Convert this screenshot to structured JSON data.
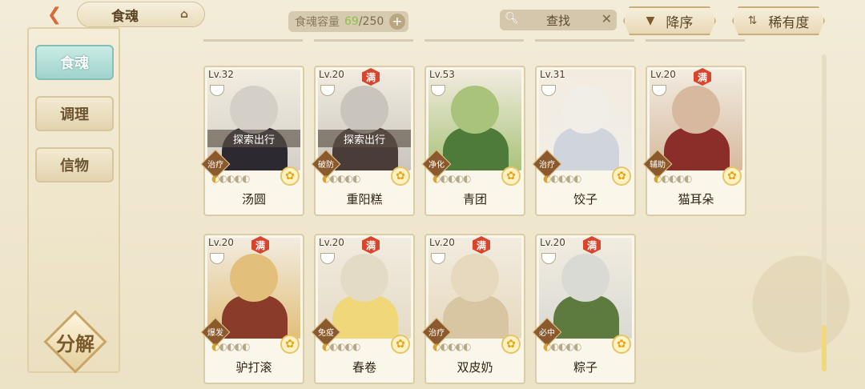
{
  "header": {
    "title": "食魂",
    "capacity_label": "食魂容量",
    "capacity_current": "69",
    "capacity_max": "/250",
    "search_placeholder": "查找",
    "sort_desc_label": "降序",
    "sort_rarity_label": "稀有度"
  },
  "sidebar": {
    "items": [
      {
        "label": "食魂"
      },
      {
        "label": "调理"
      },
      {
        "label": "信物"
      }
    ],
    "decompose_label": "分解"
  },
  "cards": [
    {
      "level": "Lv.32",
      "name": "汤圆",
      "full": false,
      "explore": "探索出行",
      "role": "治疗",
      "stars_lit": 1,
      "colors": [
        "#d4d0c8",
        "#2c2a30"
      ]
    },
    {
      "level": "Lv.20",
      "name": "重阳糕",
      "full": true,
      "explore": "探索出行",
      "role": "破防",
      "stars_lit": 1,
      "colors": [
        "#c9c4bc",
        "#4a3d38"
      ]
    },
    {
      "level": "Lv.53",
      "name": "青团",
      "full": false,
      "explore": "",
      "role": "净化",
      "stars_lit": 1,
      "colors": [
        "#a9c37a",
        "#4e7a3a"
      ]
    },
    {
      "level": "Lv.31",
      "name": "饺子",
      "full": false,
      "explore": "",
      "role": "治疗",
      "stars_lit": 1,
      "colors": [
        "#f1eee8",
        "#cfd4dd"
      ]
    },
    {
      "level": "Lv.20",
      "name": "猫耳朵",
      "full": true,
      "explore": "",
      "role": "辅助",
      "stars_lit": 1,
      "colors": [
        "#d6b99e",
        "#8b2e2a"
      ]
    },
    {
      "level": "Lv.20",
      "name": "驴打滚",
      "full": true,
      "explore": "",
      "role": "爆发",
      "stars_lit": 1,
      "colors": [
        "#e2bf7a",
        "#8a3b2a"
      ]
    },
    {
      "level": "Lv.20",
      "name": "春卷",
      "full": true,
      "explore": "",
      "role": "免疫",
      "stars_lit": 1,
      "colors": [
        "#e4dbc6",
        "#f0d77a"
      ]
    },
    {
      "level": "Lv.20",
      "name": "双皮奶",
      "full": true,
      "explore": "",
      "role": "治疗",
      "stars_lit": 1,
      "colors": [
        "#e6d9bd",
        "#d8c6a3"
      ]
    },
    {
      "level": "Lv.20",
      "name": "粽子",
      "full": true,
      "explore": "",
      "role": "必中",
      "stars_lit": 1,
      "colors": [
        "#d9dad4",
        "#5d7a3f"
      ]
    }
  ],
  "full_badge": "满",
  "colors": {
    "accent": "#d8452d",
    "active_tab": "#9fd3cc",
    "gold": "#d7a335"
  }
}
